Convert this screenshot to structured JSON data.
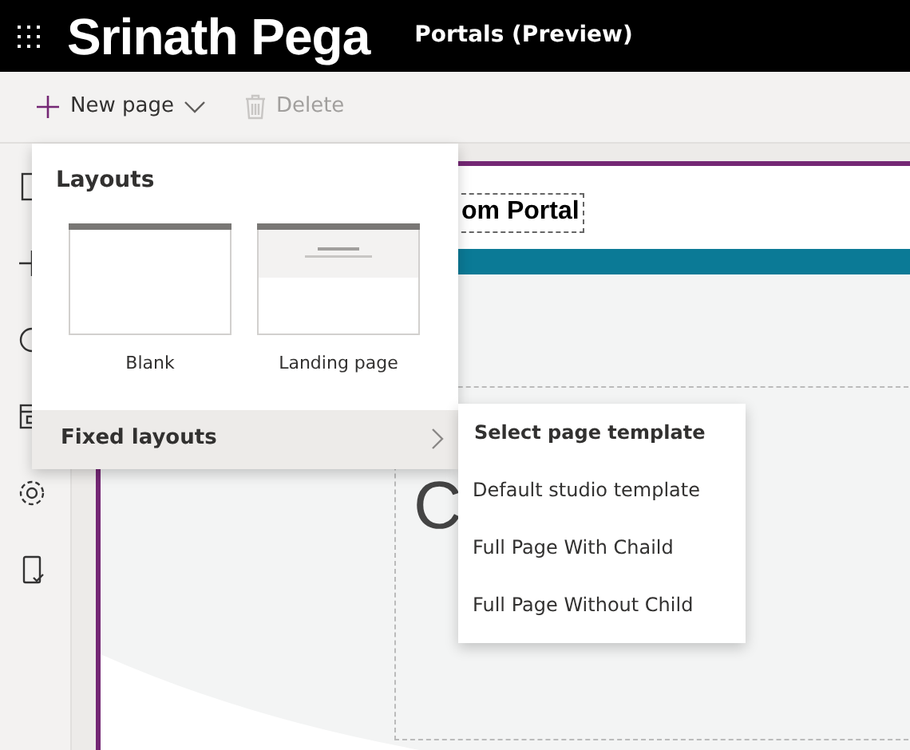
{
  "app_bar": {
    "site_name": "Srinath Pega",
    "product": "Portals (Preview)"
  },
  "toolbar": [
    {
      "label": "New page",
      "disabled": false,
      "kind": "dropdown"
    },
    {
      "label": "Delete",
      "disabled": true,
      "kind": "delete"
    }
  ],
  "canvas": {
    "header_text": "om Portal",
    "hero_text": "C"
  },
  "menu": {
    "title": "Layouts",
    "layouts": [
      {
        "label": "Blank",
        "kind": "blank"
      },
      {
        "label": "Landing page",
        "kind": "landing"
      }
    ],
    "fixed_layouts": {
      "label": "Fixed layouts",
      "expanded": true
    }
  },
  "submenu": {
    "title": "Select page template",
    "items": [
      "Default studio template",
      "Full Page With Chaild",
      "Full Page Without Child"
    ]
  }
}
